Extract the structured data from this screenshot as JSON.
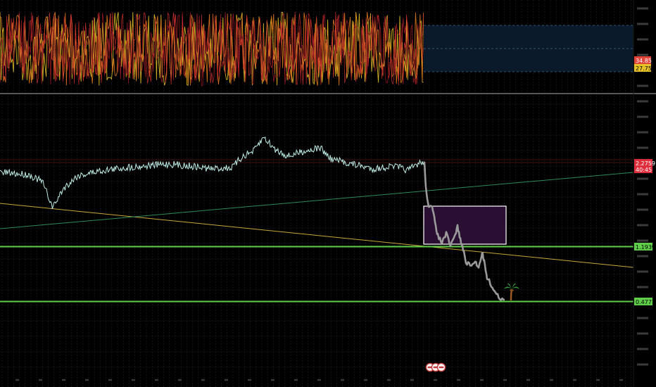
{
  "chart_data": {
    "type": "line",
    "panes": {
      "oscillator": {
        "markers": [
          {
            "value": "34.85",
            "color": "#e2443a"
          },
          {
            "value": "27.75",
            "color": "#e6c229"
          }
        ],
        "series_colors": [
          "#e6c229",
          "#e07a1e",
          "#d8342f",
          "#b0202a"
        ]
      },
      "price": {
        "last_price": "2.2759",
        "countdown": "40:45",
        "last_price_color": "#e02d3c",
        "levels": [
          {
            "value": "1.1939",
            "color": "#5fcf4a"
          },
          {
            "value": "0.4771",
            "color": "#5fcf4a"
          }
        ],
        "history_color": "#bfeee6",
        "projection_color": "#9a9a9a",
        "trendline_colors": [
          "#c8a83a",
          "#2f8a5a"
        ],
        "zone_fill": "#2a0f33",
        "icons": [
          "palm-tree-icon",
          "emoji-face-icon",
          "emoji-face-icon",
          "emoji-face-icon"
        ]
      }
    }
  }
}
